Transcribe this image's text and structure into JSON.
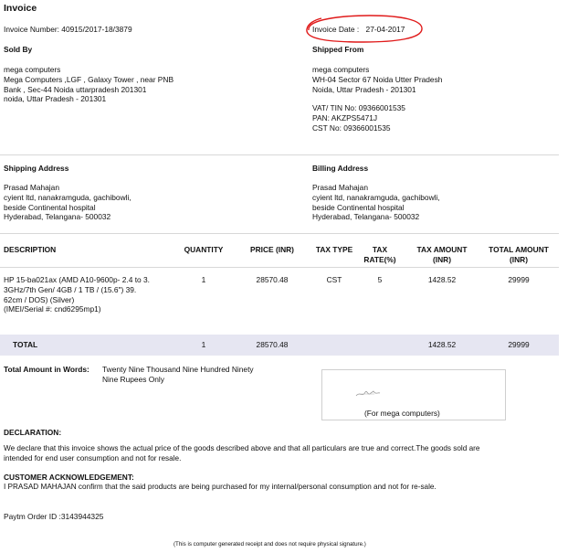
{
  "title": "Invoice",
  "invoice_number": "Invoice Number: 40915/2017-18/3879",
  "invoice_date_label": "Invoice Date :",
  "invoice_date": "27-04-2017",
  "sold_by": {
    "heading": "Sold By",
    "lines": [
      "mega computers",
      "Mega Computers ,LGF , Galaxy Tower , near PNB",
      "Bank , Sec-44 Noida uttarpradesh 201301",
      "noida, Uttar Pradesh - 201301"
    ]
  },
  "shipped_from": {
    "heading": "Shipped From",
    "lines": [
      "mega computers",
      "WH-04 Sector 67 Noida Utter Pradesh",
      "Noida, Uttar Pradesh - 201301"
    ],
    "tax_lines": [
      "VAT/ TIN No: 09366001535",
      "PAN: AKZPS5471J",
      "CST No: 09366001535"
    ]
  },
  "shipping_address": {
    "heading": "Shipping Address",
    "lines": [
      "Prasad Mahajan",
      "cyient ltd, nanakramguda, gachibowli,",
      "beside Continental hospital",
      "Hyderabad, Telangana- 500032"
    ]
  },
  "billing_address": {
    "heading": "Billing Address",
    "lines": [
      "Prasad Mahajan",
      "cyient ltd, nanakramguda, gachibowli,",
      "beside Continental hospital",
      "Hyderabad, Telangana- 500032"
    ]
  },
  "table": {
    "headers": {
      "description": "DESCRIPTION",
      "quantity": "QUANTITY",
      "price": "PRICE (INR)",
      "tax_type": "TAX TYPE",
      "tax_rate_1": "TAX",
      "tax_rate_2": "RATE(%)",
      "tax_amount_1": "TAX AMOUNT",
      "tax_amount_2": "(INR)",
      "total_amount_1": "TOTAL AMOUNT",
      "total_amount_2": "(INR)"
    },
    "item": {
      "description_lines": [
        "HP 15-ba021ax (AMD A10-9600p- 2.4 to 3.",
        "3GHz/7th Gen/ 4GB / 1 TB / (15.6\") 39.",
        "62cm / DOS) (Silver)",
        "(IMEI/Serial #: cnd6295mp1)"
      ],
      "quantity": "1",
      "price": "28570.48",
      "tax_type": "CST",
      "tax_rate": "5",
      "tax_amount": "1428.52",
      "total_amount": "29999"
    },
    "total_row": {
      "label": "TOTAL",
      "quantity": "1",
      "price": "28570.48",
      "tax_amount": "1428.52",
      "total_amount": "29999"
    }
  },
  "amount_in_words": {
    "label": "Total Amount in Words:",
    "line1": "Twenty Nine Thousand Nine Hundred Ninety",
    "line2": "Nine  Rupees Only"
  },
  "signature": {
    "caption": "(For mega computers)"
  },
  "declaration": {
    "heading": "DECLARATION:",
    "line1": "We declare that this invoice shows the actual price of the goods described above and that all particulars are true and correct.The goods sold are",
    "line2": "intended for end user consumption and not for resale."
  },
  "acknowledgement": {
    "heading": "CUSTOMER ACKNOWLEDGEMENT:",
    "text": "I PRASAD MAHAJAN confirm that the said products are being purchased for my internal/personal consumption and not for re-sale."
  },
  "paytm_order": "Paytm Order ID :3143944325",
  "footer_note": "(This is computer generated receipt and does not require physical signature.)",
  "colors": {
    "annotation_circle": "#e01a1a",
    "total_band": "#e6e6f2"
  }
}
